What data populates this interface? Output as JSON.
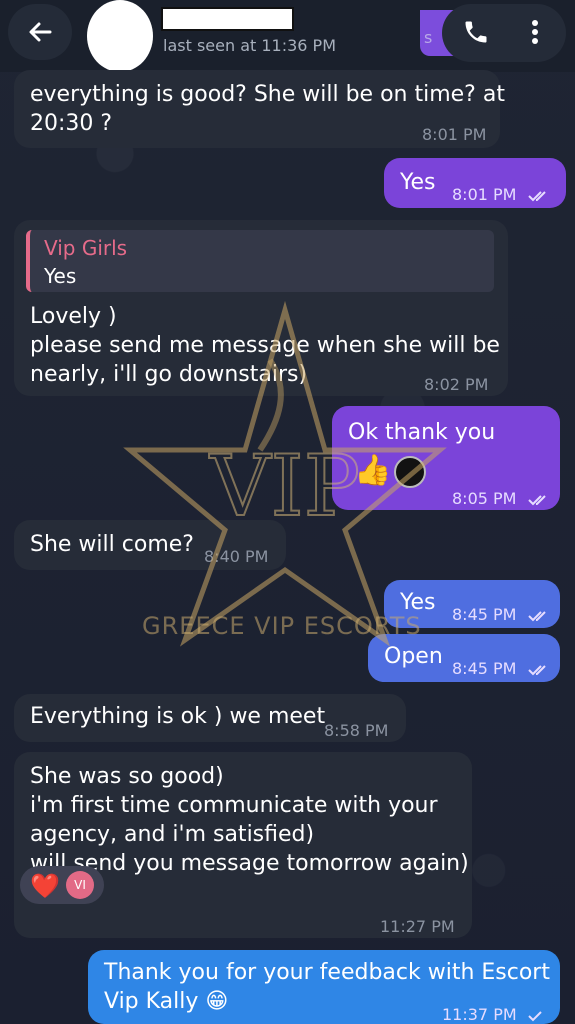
{
  "header": {
    "last_seen": "last seen at 11:36 PM",
    "partial_text": "s"
  },
  "messages": [
    {
      "text": "everything is good? She will be on time? at\n20:30 ?",
      "time": "8:01 PM"
    },
    {
      "text": "Yes",
      "time": "8:01 PM"
    },
    {
      "reply_to_name": "Vip Girls",
      "reply_to_text": "Yes",
      "text": "Lovely )\nplease send me message when she will be\nnearly, i'll go downstairs)",
      "time": "8:02 PM"
    },
    {
      "text": "Ok thank you",
      "time": "8:05 PM",
      "emoji": "👍"
    },
    {
      "text": "She will come?",
      "time": "8:40 PM"
    },
    {
      "text": "Yes",
      "time": "8:45 PM"
    },
    {
      "text": "Open",
      "time": "8:45 PM"
    },
    {
      "text": "Everything is ok ) we meet",
      "time": "8:58 PM"
    },
    {
      "text": "She was so good)\ni'm first time communicate with your\nagency, and i'm satisfied)\nwill send you message tomorrow again)",
      "time": "11:27 PM",
      "reaction": "❤️",
      "reaction_avatar": "VI"
    },
    {
      "text": "Thank you for your feedback with Escort\nVip Kally 😁",
      "time": "11:37 PM"
    }
  ],
  "watermark": {
    "letters": "VIP",
    "text": "GREECE VIP ESCORTS"
  },
  "icons": [
    "back-arrow-icon",
    "phone-icon",
    "more-vertical-icon",
    "double-check-icon",
    "single-check-icon",
    "heart-icon",
    "thumbs-up-icon"
  ],
  "colors": {
    "incoming": "#262c38",
    "outgoing": "#7b44d9",
    "outgoing_blue": "#4f6ee0",
    "final": "#2f86e6",
    "reply_accent": "#e66b8a"
  }
}
